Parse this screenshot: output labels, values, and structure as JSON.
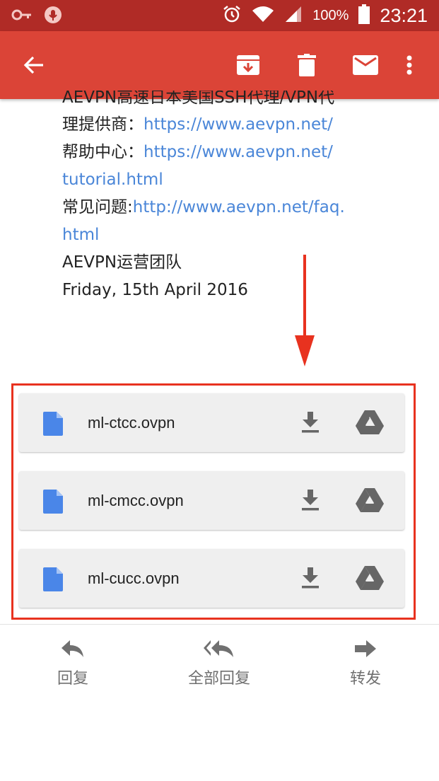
{
  "status_bar": {
    "battery": "100%",
    "time": "23:21",
    "icons": [
      "key-icon",
      "mic-icon",
      "alarm-icon",
      "wifi-icon",
      "signal-icon",
      "battery-icon"
    ]
  },
  "app_bar": {
    "icons": [
      "back-arrow-icon",
      "archive-icon",
      "delete-icon",
      "mark-unread-icon",
      "more-vert-icon"
    ]
  },
  "message": {
    "lines": [
      {
        "text": "AEVPN高速日本美国SSH代理/VPN代",
        "link": ""
      },
      {
        "text": "理提供商：",
        "link": "https://www.aevpn.net/"
      },
      {
        "text": "帮助中心：",
        "link": "https://www.aevpn.net/"
      },
      {
        "text": "",
        "link": "tutorial.html"
      },
      {
        "text": "常见问题:",
        "link": "http://www.aevpn.net/faq."
      },
      {
        "text": "",
        "link": "html"
      },
      {
        "text": "AEVPN运营团队",
        "link": ""
      },
      {
        "text": "Friday, 15th April 2016",
        "link": ""
      }
    ]
  },
  "attachments": [
    {
      "name": "ml-ctcc.ovpn"
    },
    {
      "name": "ml-cmcc.ovpn"
    },
    {
      "name": "ml-cucc.ovpn"
    }
  ],
  "actions": {
    "reply": "回复",
    "reply_all": "全部回复",
    "forward": "转发"
  },
  "colors": {
    "status_bar": "#b02b26",
    "app_bar": "#db4437",
    "link": "#4a86d8",
    "highlight": "#e8321f",
    "file_icon": "#4a86e8"
  }
}
